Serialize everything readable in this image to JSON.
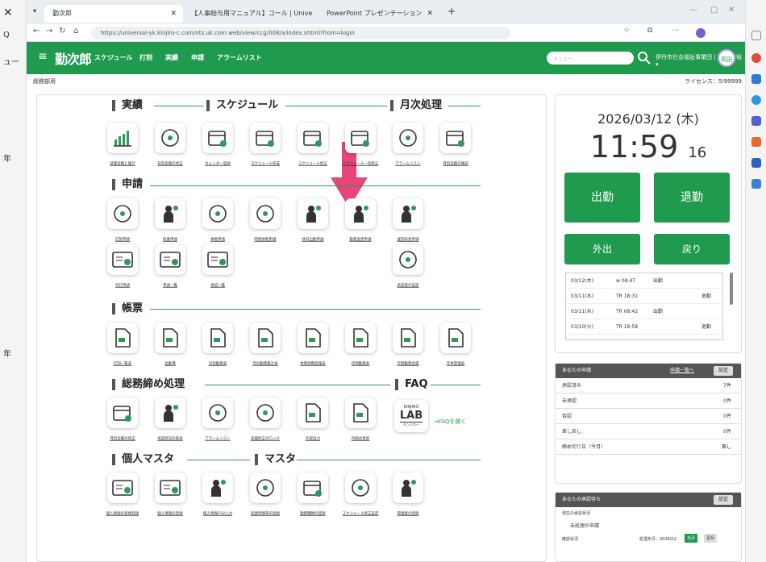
{
  "browser": {
    "tabs": [
      {
        "label": "勤次郎"
      },
      {
        "label": "【人事給与用マニュアル】コール | Unive"
      },
      {
        "label": "PowerPoint プレゼンテーション"
      }
    ],
    "url": "https://universal-yk.kinjiro-c.com/nts.uk.com.web/view/ccg/008/a/index.xhtml?from=login"
  },
  "header": {
    "logo": "勤次郎",
    "menu": [
      "スケジュール",
      "打刻",
      "実績",
      "申請",
      "アラームリスト"
    ],
    "search_placeholder": "メニュー",
    "user": "伊丹市社会福祉事業団 | 高田 幸裕 ▾",
    "avatar": "高田"
  },
  "subbar": {
    "left": "総務部用",
    "right": "ライセンス：5/99999"
  },
  "sections": {
    "jisseki": "実績",
    "schedule": "スケジュール",
    "getsuji": "月次処理",
    "shinsei": "申請",
    "chohyo": "帳票",
    "somu": "総務締め処理",
    "faq": "FAQ",
    "kojin": "個人マスタ",
    "master": "マスタ"
  },
  "row1": [
    "就業実績と集計",
    "日別実績の修正",
    "カレンダー登録",
    "スケジュール作成",
    "スケジュール修正",
    "スケジュール一括修正",
    "アラームリスト",
    "月別実績の確認"
  ],
  "row2": [
    "打刻申請",
    "残業申請",
    "休暇申請",
    "時間休暇申請",
    "休日出勤申請",
    "勤務変更申請",
    "遅刻早退申請"
  ],
  "row3": [
    "代行申請",
    "申請一覧",
    "承認一覧",
    "承認者の設定"
  ],
  "row4": [
    "打刻一覧表",
    "出勤簿",
    "日別勤務表",
    "月別勤務集計表",
    "休暇残数管理表",
    "年間勤務表",
    "年間勤務台帳",
    "年休管理表"
  ],
  "row5": [
    "月別実績の修正",
    "承認状況の照会",
    "アラームリスト",
    "実績修正のロック",
    "外部出力",
    "月締め更新"
  ],
  "faq": {
    "brand_top": "KINJIRO",
    "brand": "LAB",
    "brand_sub": "キンジロー",
    "link": "→FAQを開く"
  },
  "row6": [
    "個人情報の新規登録",
    "個人情報の登録",
    "個人情報CSV入力",
    "就業時間帯の登録",
    "勤務種類の登録",
    "スケジュール修正設定",
    "管理者の登録"
  ],
  "clock": {
    "date": "2026/03/12 (木)",
    "time": "11:59",
    "sec": "16"
  },
  "buttons": {
    "in": "出勤",
    "out": "退勤",
    "go": "外出",
    "back": "戻り"
  },
  "logs": [
    {
      "d": "03/12(木)",
      "t": "w 08:47",
      "k": "出勤"
    },
    {
      "d": "03/11(水)",
      "t": "TR 18:31",
      "k": "退勤"
    },
    {
      "d": "03/11(水)",
      "t": "TR 08:42",
      "k": "出勤"
    },
    {
      "d": "03/10(火)",
      "t": "TR 18:58",
      "k": "退勤"
    }
  ],
  "apps": {
    "title": "あなたの申請",
    "link": "申請一覧へ",
    "set": "設定",
    "rows": [
      {
        "k": "承認済み",
        "v": "7件"
      },
      {
        "k": "未承認",
        "v": "0件"
      },
      {
        "k": "否認",
        "v": "0件"
      },
      {
        "k": "差し戻し",
        "v": "0件"
      },
      {
        "k": "締め切り日（今月）",
        "v": "無し"
      }
    ]
  },
  "approval": {
    "title": "あなたの承認待ち",
    "set": "設定",
    "status": "現在の承認状況",
    "unproc": "未処理の申請",
    "conf": "確認状況",
    "month": "処理年月：2026/02",
    "cur": "当月",
    "next": "翌月"
  },
  "left_strip": [
    "Q",
    "ュー",
    "年",
    "年"
  ]
}
